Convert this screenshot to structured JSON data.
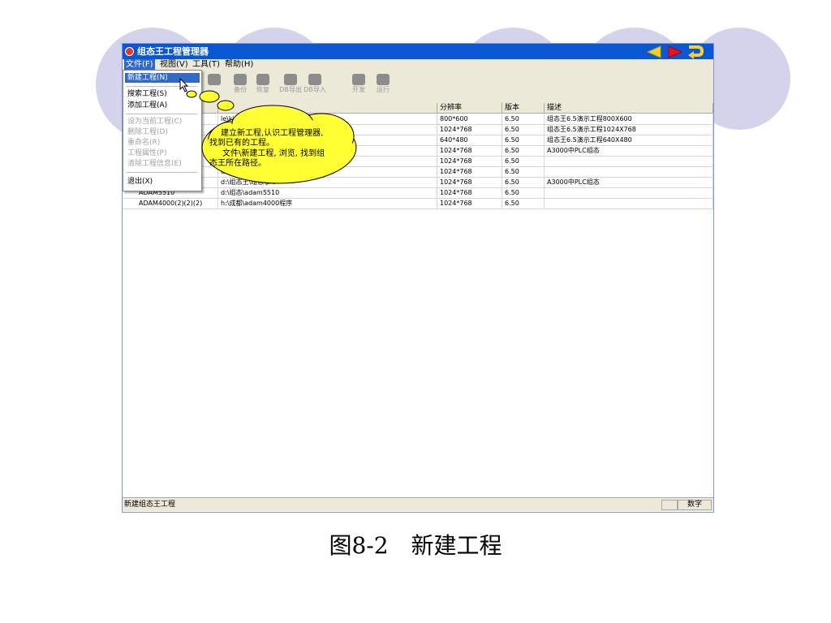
{
  "window": {
    "title": "组态王工程管理器"
  },
  "menubar": [
    "文件(F)",
    "视图(V)",
    "工具(T)",
    "帮助(H)"
  ],
  "toolbar": [
    {
      "label": "",
      "icon": "search-folder-icon"
    },
    {
      "label": "",
      "icon": "properties-icon"
    },
    {
      "label": "备份",
      "icon": "backup-icon"
    },
    {
      "label": "恢复",
      "icon": "restore-icon"
    },
    {
      "label": "DB导出",
      "icon": "db-export-icon"
    },
    {
      "label": "DB导入",
      "icon": "db-import-icon"
    },
    {
      "label": "开发",
      "icon": "develop-icon"
    },
    {
      "label": "运行",
      "icon": "run-icon"
    }
  ],
  "grid": {
    "columns": [
      "",
      "",
      "分辨率",
      "版本",
      "描述"
    ],
    "rows": [
      {
        "name": "",
        "path": "le\\kingdemo2",
        "resolution": "800*600",
        "version": "6.50",
        "desc": "组态王6.5演示工程800X600"
      },
      {
        "name": "",
        "path": "kingdemo3",
        "resolution": "1024*768",
        "version": "6.50",
        "desc": "组态王6.5演示工程1024X768"
      },
      {
        "name": "",
        "path": "gdemo1",
        "resolution": "640*480",
        "version": "6.50",
        "desc": "组态王6.5演示工程640X480"
      },
      {
        "name": "",
        "path": "",
        "resolution": "1024*768",
        "version": "6.50",
        "desc": "A3000中PLC组态"
      },
      {
        "name": "",
        "path": "",
        "resolution": "1024*768",
        "version": "6.50",
        "desc": ""
      },
      {
        "name": "",
        "path": "d:\\组态",
        "resolution": "1024*768",
        "version": "6.50",
        "desc": ""
      },
      {
        "name": "PLC组态(2)",
        "path": "d:\\组态王\\组态\\plc",
        "resolution": "1024*768",
        "version": "6.50",
        "desc": "A3000中PLC组态"
      },
      {
        "name": "ADAM5510",
        "path": "d:\\组态\\adam5510",
        "resolution": "1024*768",
        "version": "6.50",
        "desc": ""
      },
      {
        "name": "ADAM4000(2)(2)(2)",
        "path": "h:\\成都\\adam4000程序",
        "resolution": "1024*768",
        "version": "6.50",
        "desc": ""
      }
    ]
  },
  "file_menu": {
    "items": [
      {
        "label": "新建工程(N)",
        "state": "highlighted"
      },
      {
        "label": "搜索工程(S)",
        "state": "enabled"
      },
      {
        "label": "添加工程(A)",
        "state": "enabled"
      },
      {
        "label": "设为当前工程(C)",
        "state": "disabled"
      },
      {
        "label": "删除工程(D)",
        "state": "disabled"
      },
      {
        "label": "重命名(R)",
        "state": "disabled"
      },
      {
        "label": "工程属性(P)",
        "state": "disabled"
      },
      {
        "label": "清除工程信息(E)",
        "state": "disabled"
      },
      {
        "label": "退出(X)",
        "state": "enabled"
      }
    ]
  },
  "callout": {
    "line1": "建立新工程,认识工程管理器,",
    "line2": "找到已有的工程。",
    "line3": "文件\\新建工程, 浏览, 找到组",
    "line4": "态王所在路径。"
  },
  "statusbar": {
    "text": "新建组态王工程",
    "indicator": "数字"
  },
  "caption": "图8-2　新建工程",
  "colors": {
    "titlebar": "#0a57d4",
    "callout_fill": "#ffff33",
    "menu_highlight": "#316ac5",
    "deco_circle": "#d3d3ec"
  }
}
